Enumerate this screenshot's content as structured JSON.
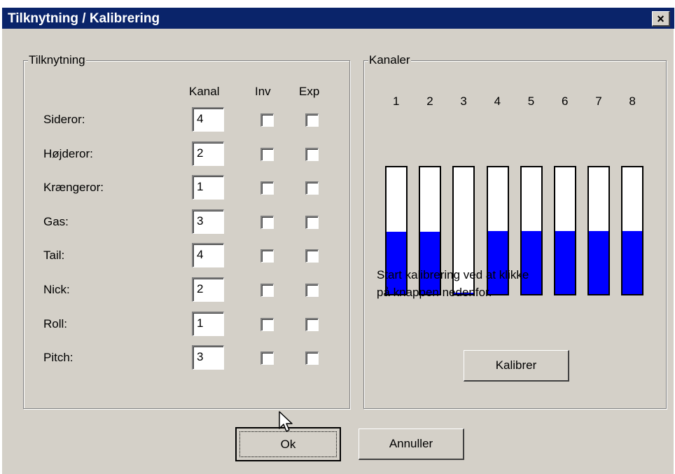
{
  "window": {
    "title": "Tilknytning / Kalibrering",
    "close_glyph": "×"
  },
  "assignment": {
    "legend": "Tilknytning",
    "headers": {
      "kanal": "Kanal",
      "inv": "Inv",
      "exp": "Exp"
    },
    "rows": [
      {
        "label": "Sideror:",
        "channel": "4",
        "inv": false,
        "exp": false
      },
      {
        "label": "Højderor:",
        "channel": "2",
        "inv": false,
        "exp": false
      },
      {
        "label": "Krængeror:",
        "channel": "1",
        "inv": false,
        "exp": false
      },
      {
        "label": "Gas:",
        "channel": "3",
        "inv": false,
        "exp": false
      },
      {
        "label": "Tail:",
        "channel": "4",
        "inv": false,
        "exp": false
      },
      {
        "label": "Nick:",
        "channel": "2",
        "inv": false,
        "exp": false
      },
      {
        "label": "Roll:",
        "channel": "1",
        "inv": false,
        "exp": false
      },
      {
        "label": "Pitch:",
        "channel": "3",
        "inv": false,
        "exp": false
      }
    ]
  },
  "channels": {
    "legend": "Kanaler",
    "bar_color": "#0000ff",
    "items": [
      {
        "number": "1",
        "level": 0.49
      },
      {
        "number": "2",
        "level": 0.49
      },
      {
        "number": "3",
        "level": 0.01
      },
      {
        "number": "4",
        "level": 0.5
      },
      {
        "number": "5",
        "level": 0.5
      },
      {
        "number": "6",
        "level": 0.5
      },
      {
        "number": "7",
        "level": 0.5
      },
      {
        "number": "8",
        "level": 0.5
      }
    ],
    "instruction_line1": "Start kalibrering ved at klikke",
    "instruction_line2": "på knappen nedenfor.",
    "calibrate_label": "Kalibrer"
  },
  "footer": {
    "ok_label": "Ok",
    "cancel_label": "Annuller"
  },
  "colors": {
    "titlebar": "#0a246a",
    "face": "#d4d0c8"
  }
}
